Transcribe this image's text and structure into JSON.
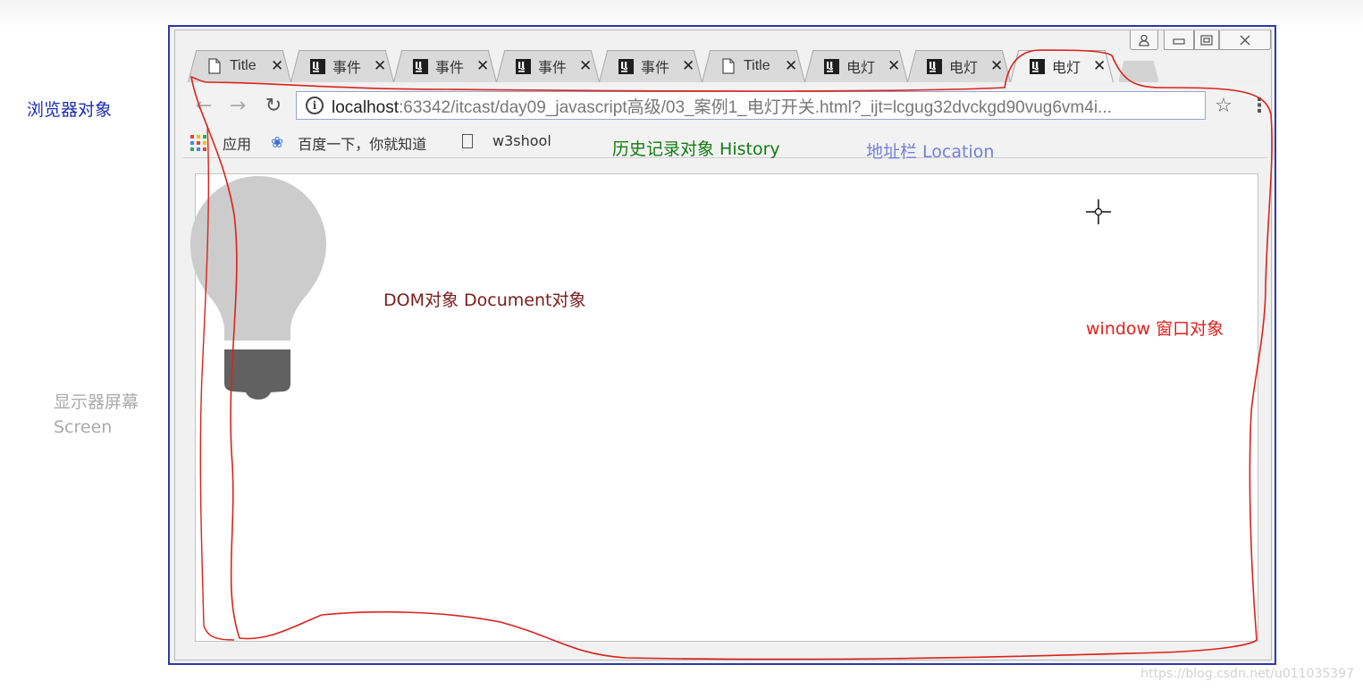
{
  "labels": {
    "browser": "浏览器对象",
    "screen_line1": "显示器屏幕",
    "screen_line2": "Screen"
  },
  "window_controls": {
    "user": "⍝",
    "minimize": "▭",
    "maximize": "▣",
    "close": "✕"
  },
  "tabs": [
    {
      "icon": "page-icon",
      "title": "Title",
      "close": "✕"
    },
    {
      "icon": "intellij-icon",
      "title": "事件",
      "close": "✕"
    },
    {
      "icon": "intellij-icon",
      "title": "事件",
      "close": "✕"
    },
    {
      "icon": "intellij-icon",
      "title": "事件",
      "close": "✕"
    },
    {
      "icon": "intellij-icon",
      "title": "事件",
      "close": "✕"
    },
    {
      "icon": "page-icon",
      "title": "Title",
      "close": "✕"
    },
    {
      "icon": "intellij-icon",
      "title": "电灯",
      "close": "✕"
    },
    {
      "icon": "intellij-icon",
      "title": "电灯",
      "close": "✕"
    },
    {
      "icon": "intellij-icon",
      "title": "电灯",
      "close": "✕",
      "active": true
    }
  ],
  "toolbar": {
    "back": "←",
    "forward": "→",
    "reload": "↻",
    "info": "i",
    "url_host": "localhost",
    "url_path": ":63342/itcast/day09_javascript高级/03_案例1_电灯开关.html?_ijt=lcgug32dvckgd90vug6vm4i...",
    "star": "☆",
    "menu": "⋮"
  },
  "bookmarks": {
    "apps": "应用",
    "baidu": "百度一下，你就知道",
    "w3shool": "w3shool"
  },
  "annotations": {
    "history": "历史记录对象 History",
    "location": "地址栏 Location",
    "dom": "DOM对象 Document对象",
    "window": "window 窗口对象"
  },
  "colors": {
    "browser_label": "#1a2fb0",
    "history": "#147a14",
    "location": "#7280d8",
    "dom": "#7a1c1c",
    "window": "#e0201c",
    "bulb": "#cccccc",
    "bulb_base": "#616161"
  },
  "watermark": "https://blog.csdn.net/u011035397"
}
